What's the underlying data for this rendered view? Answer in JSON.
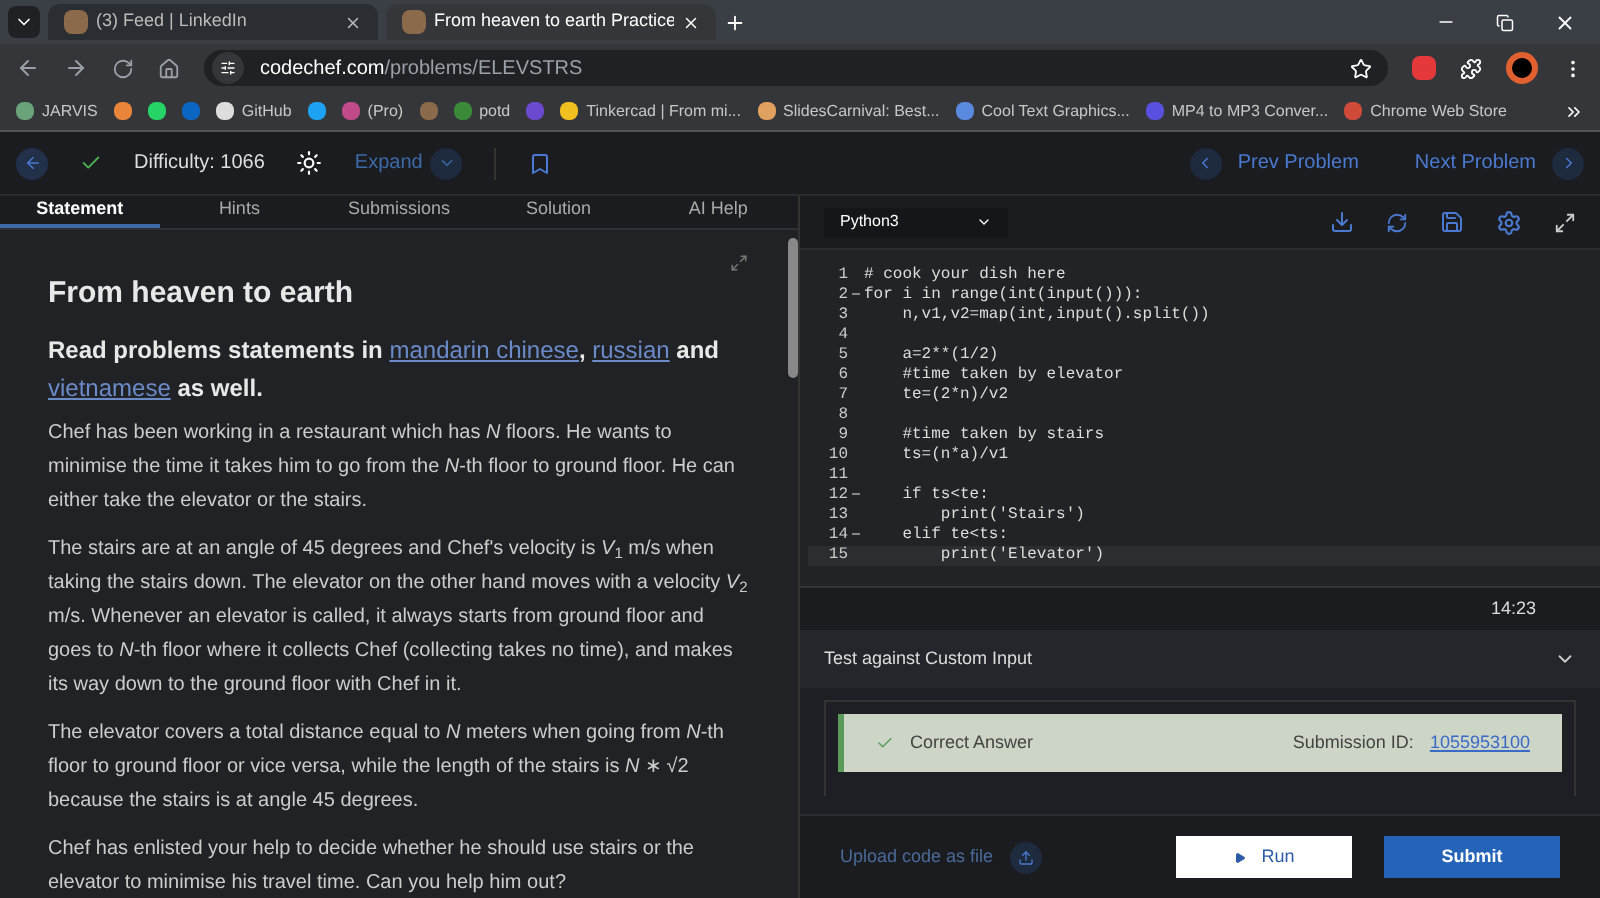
{
  "browser": {
    "tabs": [
      {
        "title": "(3) Feed | LinkedIn",
        "selected": false
      },
      {
        "title": "From heaven to earth Practice",
        "selected": true
      }
    ],
    "address": {
      "host": "codechef.com",
      "path": "/problems/ELEVSTRS"
    },
    "bookmarks": [
      {
        "kind": "link",
        "label": "JARVIS"
      },
      {
        "kind": "icon"
      },
      {
        "kind": "icon"
      },
      {
        "kind": "icon"
      },
      {
        "kind": "link",
        "label": "GitHub"
      },
      {
        "kind": "icon"
      },
      {
        "kind": "link",
        "label": "(Pro)"
      },
      {
        "kind": "icon"
      },
      {
        "kind": "link",
        "label": "potd"
      },
      {
        "kind": "icon"
      },
      {
        "kind": "link",
        "label": "Tinkercad | From mi..."
      },
      {
        "kind": "link",
        "label": "SlidesCarnival: Best..."
      },
      {
        "kind": "link",
        "label": "Cool Text Graphics..."
      },
      {
        "kind": "link",
        "label": "MP4 to MP3 Conver..."
      },
      {
        "kind": "link",
        "label": "Chrome Web Store"
      }
    ]
  },
  "toolbar": {
    "difficulty": "Difficulty: 1066",
    "expand": "Expand",
    "solved": true,
    "prev": "Prev Problem",
    "next": "Next Problem"
  },
  "tabs": [
    {
      "label": "Statement",
      "selected": true
    },
    {
      "label": "Hints",
      "selected": false
    },
    {
      "label": "Submissions",
      "selected": false
    },
    {
      "label": "Solution",
      "selected": false
    },
    {
      "label": "AI Help",
      "selected": false
    }
  ],
  "statement": {
    "title": "From heaven to earth",
    "intro": {
      "before": "Read problems statements in ",
      "links": [
        "mandarin chinese",
        "russian",
        "vietnamese"
      ],
      "sep": ", ",
      "and": " and ",
      "after": " as well."
    },
    "paragraphs": [
      "Chef has been working in a restaurant which has *N* floors. He wants to minimise the time it takes him to go from the *N*-th floor to ground floor. He can either take the elevator or the stairs.",
      "The stairs are at an angle of 45 degrees and Chef's velocity is *V*$_{1}$ m/s when taking the stairs down. The elevator on the other hand moves with a velocity *V*$_{2}$ m/s. Whenever an elevator is called, it always starts from ground floor and goes to *N*-th floor where it collects Chef (collecting takes no time), and makes its way down to the ground floor with Chef in it.",
      "The elevator covers a total distance equal to *N* meters when going from *N*-th floor to ground floor or vice versa, while the length of the stairs is *N* ∗ √2 because the stairs is at angle 45 degrees.",
      "Chef has enlisted your help to decide whether he should use stairs or the elevator to minimise his travel time. Can you help him out?"
    ]
  },
  "editor": {
    "language": "Python3",
    "lines": [
      {
        "num": "1",
        "code": "# cook your dish here",
        "foldable": false,
        "current": false
      },
      {
        "num": "2",
        "code": "for i in range(int(input())):",
        "foldable": true,
        "current": false
      },
      {
        "num": "3",
        "code": "    n,v1,v2=map(int,input().split())",
        "foldable": false,
        "current": false
      },
      {
        "num": "4",
        "foldable": false,
        "current": false
      },
      {
        "num": "5",
        "code": "    a=2**(1/2)",
        "foldable": false,
        "current": false
      },
      {
        "num": "6",
        "code": "    #time taken by elevator",
        "foldable": false,
        "current": false
      },
      {
        "num": "7",
        "code": "    te=(2*n)/v2",
        "foldable": false,
        "current": false
      },
      {
        "num": "8",
        "foldable": false,
        "current": false
      },
      {
        "num": "9",
        "code": "    #time taken by stairs",
        "foldable": false,
        "current": false
      },
      {
        "num": "10",
        "code": "    ts=(n*a)/v1",
        "foldable": false,
        "current": false
      },
      {
        "num": "11",
        "foldable": false,
        "current": false
      },
      {
        "num": "12",
        "code": "    if ts<te:",
        "foldable": true,
        "current": false
      },
      {
        "num": "13",
        "code": "        print('Stairs')",
        "foldable": false,
        "current": false
      },
      {
        "num": "14",
        "code": "    elif te<ts:",
        "foldable": true,
        "current": false
      },
      {
        "num": "15",
        "code": "        print('Elevator')",
        "foldable": false,
        "current": true
      }
    ],
    "timer": "14:23"
  },
  "custom_input": {
    "label": "Test against Custom Input"
  },
  "result": {
    "status": "Correct Answer",
    "id_label": "Submission ID:",
    "id": "1055953100"
  },
  "actions": {
    "upload": "Upload code as file",
    "run": "Run",
    "submit": "Submit"
  }
}
